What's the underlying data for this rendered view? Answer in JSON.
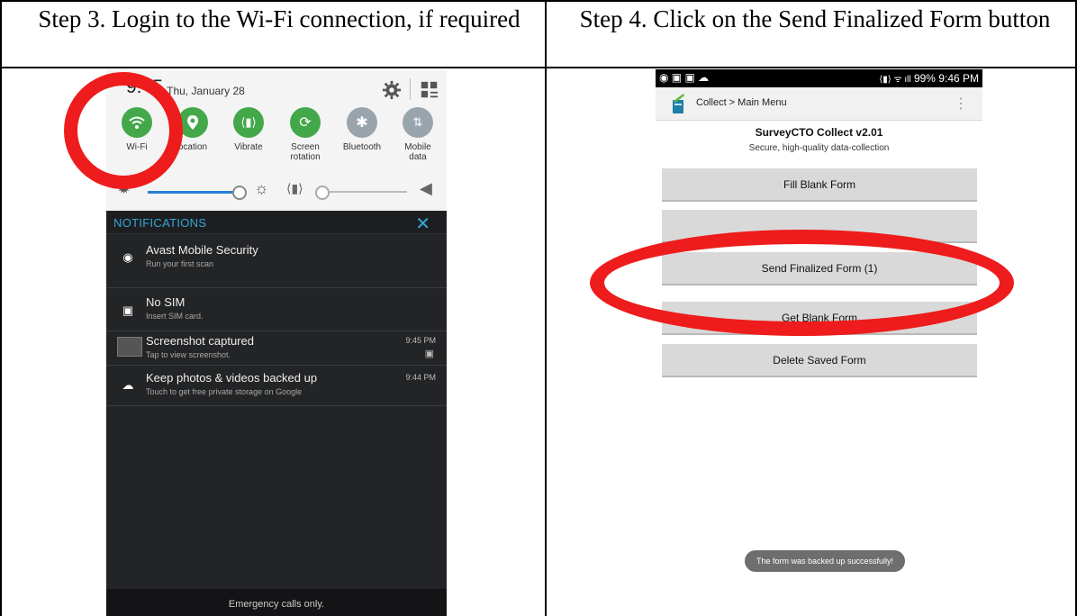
{
  "doc": {
    "step3_heading": "Step 3. Login to the Wi-Fi connection, if required",
    "step4_heading": "Step 4. Click on the Send Finalized Form button"
  },
  "left_phone": {
    "time": "9:45",
    "time_suffix": "M",
    "date": "Thu, January 28",
    "tiles": [
      {
        "label": "Wi-Fi",
        "icon": "wifi-icon"
      },
      {
        "label": "ocation",
        "icon": "location-icon"
      },
      {
        "label": "Vibrate",
        "icon": "vibrate-icon"
      },
      {
        "label": "Screen rotation",
        "icon": "screen-rotation-icon"
      },
      {
        "label": "Bluetooth",
        "icon": "bluetooth-icon"
      },
      {
        "label": "Mobile data",
        "icon": "mobile-data-icon"
      }
    ],
    "notifications_title": "NOTIFICATIONS",
    "notifications": [
      {
        "title": "Avast Mobile Security",
        "subtitle": "Run your first scan",
        "time": ""
      },
      {
        "title": "No SIM",
        "subtitle": "Insert SIM card.",
        "time": ""
      },
      {
        "title": "Screenshot captured",
        "subtitle": "Tap to view screenshot.",
        "time": "9:45 PM"
      },
      {
        "title": "Keep photos & videos backed up",
        "subtitle": "Touch to get free private storage on Google",
        "time": "9:44 PM"
      }
    ],
    "footer": "Emergency calls only."
  },
  "right_phone": {
    "status_right": "99% 9:46 PM",
    "breadcrumb": "Collect > Main Menu",
    "app_title": "SurveyCTO Collect v2.01",
    "app_subtitle": "Secure, high-quality data-collection",
    "buttons": [
      {
        "label": "Fill Blank Form"
      },
      {
        "label": ""
      },
      {
        "label": "Send Finalized Form (1)"
      },
      {
        "label": "Get Blank Form"
      },
      {
        "label": "Delete Saved Form"
      }
    ],
    "toast": "The form was backed up successfully!"
  },
  "colors": {
    "highlight": "#ee1c1c",
    "tile_on": "#43a84a",
    "tile_off": "#9aa4ad",
    "notif_accent": "#36a6d8"
  }
}
